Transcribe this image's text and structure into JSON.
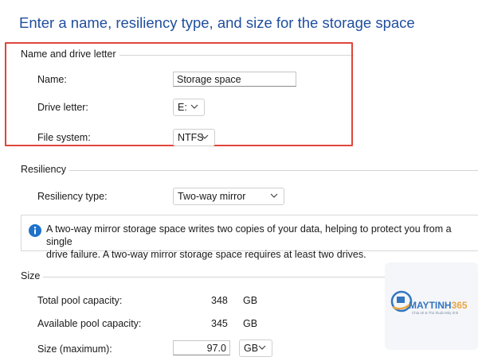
{
  "heading": "Enter a name, resiliency type, and size for the storage space",
  "name_group": {
    "title": "Name and drive letter",
    "name_label": "Name:",
    "name_value": "Storage space",
    "drive_label": "Drive letter:",
    "drive_value": "E:",
    "fs_label": "File system:",
    "fs_value": "NTFS"
  },
  "resiliency_group": {
    "title": "Resiliency",
    "type_label": "Resiliency type:",
    "type_value": "Two-way mirror",
    "info_line1": "A two-way mirror storage space writes two copies of your data, helping to protect you from a single",
    "info_line2": "drive failure. A two-way mirror storage space requires at least two drives."
  },
  "size_group": {
    "title": "Size",
    "total_label": "Total pool capacity:",
    "total_value": "348",
    "total_unit": "GB",
    "avail_label": "Available pool capacity:",
    "avail_value": "345",
    "avail_unit": "GB",
    "size_label": "Size (maximum):",
    "size_value": "97.0",
    "size_unit": "GB"
  },
  "watermark": {
    "brand_main": "MAYTINH",
    "brand_accent": "365",
    "tagline": "Chia sẻ & Thủ thuật Máy tính"
  },
  "colors": {
    "heading": "#1f4e9e",
    "highlight": "#e0453b",
    "info_icon": "#1e72c9"
  }
}
